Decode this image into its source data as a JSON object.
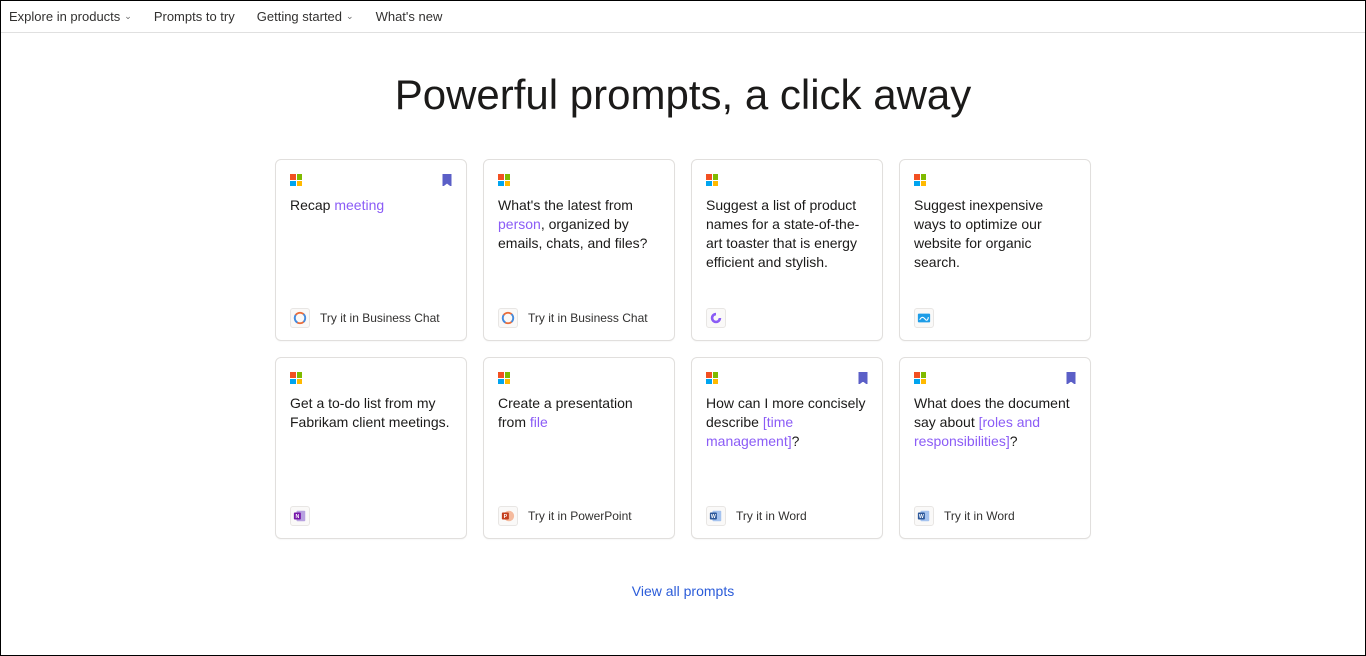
{
  "nav": {
    "items": [
      {
        "label": "Explore in products",
        "hasChevron": true
      },
      {
        "label": "Prompts to try",
        "hasChevron": false
      },
      {
        "label": "Getting started",
        "hasChevron": true
      },
      {
        "label": "What's new",
        "hasChevron": false
      }
    ]
  },
  "hero": "Powerful prompts, a click away",
  "cards": [
    {
      "textParts": [
        "Recap ",
        "meeting",
        ""
      ],
      "hiIdx": 1,
      "bookmarked": true,
      "app": "bizchat",
      "appLabel": "Try it in Business Chat"
    },
    {
      "textParts": [
        "What's the latest from ",
        "person",
        ", organized by emails, chats, and files?"
      ],
      "hiIdx": 1,
      "bookmarked": false,
      "app": "bizchat",
      "appLabel": "Try it in Business Chat"
    },
    {
      "textParts": [
        "Suggest a list of product names for a state-of-the-art toaster that is energy efficient and stylish."
      ],
      "hiIdx": -1,
      "bookmarked": false,
      "app": "loop",
      "appLabel": ""
    },
    {
      "textParts": [
        "Suggest inexpensive ways to optimize our website for organic search."
      ],
      "hiIdx": -1,
      "bookmarked": false,
      "app": "whiteboard",
      "appLabel": ""
    },
    {
      "textParts": [
        "Get a to-do list from my Fabrikam client meetings."
      ],
      "hiIdx": -1,
      "bookmarked": false,
      "app": "onenote",
      "appLabel": ""
    },
    {
      "textParts": [
        "Create a presentation from ",
        "file",
        ""
      ],
      "hiIdx": 1,
      "bookmarked": false,
      "app": "powerpoint",
      "appLabel": "Try it in PowerPoint"
    },
    {
      "textParts": [
        "How can I more concisely describe ",
        "[time management]",
        "?"
      ],
      "hiIdx": 1,
      "bookmarked": true,
      "app": "word",
      "appLabel": "Try it in Word"
    },
    {
      "textParts": [
        "What does the document say about ",
        "[roles and responsibilities]",
        "?"
      ],
      "hiIdx": 1,
      "bookmarked": true,
      "app": "word",
      "appLabel": "Try it in Word"
    }
  ],
  "viewAll": "View all prompts",
  "appIcons": {
    "bizchat": "bizchat",
    "loop": "loop",
    "whiteboard": "whiteboard",
    "onenote": "onenote",
    "powerpoint": "powerpoint",
    "word": "word"
  }
}
